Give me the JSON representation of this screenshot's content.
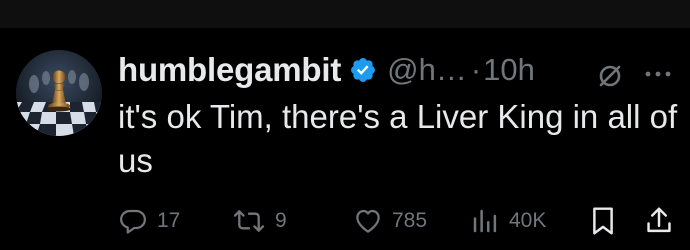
{
  "tweet": {
    "author": {
      "display_name": "humblegambit",
      "handle": "@h…",
      "verified": true,
      "avatar": "chess-pawn-avatar"
    },
    "separator": "·",
    "timestamp": "10h",
    "text": "it's ok Tim, there's a Liver King in all of us",
    "icons": {
      "grok": "grok-slash-icon",
      "more": "more-icon"
    },
    "actions": {
      "reply": {
        "icon": "reply-icon",
        "count": "17"
      },
      "repost": {
        "icon": "repost-icon",
        "count": "9"
      },
      "like": {
        "icon": "heart-icon",
        "count": "785"
      },
      "views": {
        "icon": "views-icon",
        "count": "40K"
      },
      "bookmark": {
        "icon": "bookmark-icon"
      },
      "share": {
        "icon": "share-icon"
      }
    }
  },
  "colors": {
    "background": "#000000",
    "text": "#e7e9ea",
    "secondary": "#71767b",
    "verified": "#1d9bf0"
  }
}
